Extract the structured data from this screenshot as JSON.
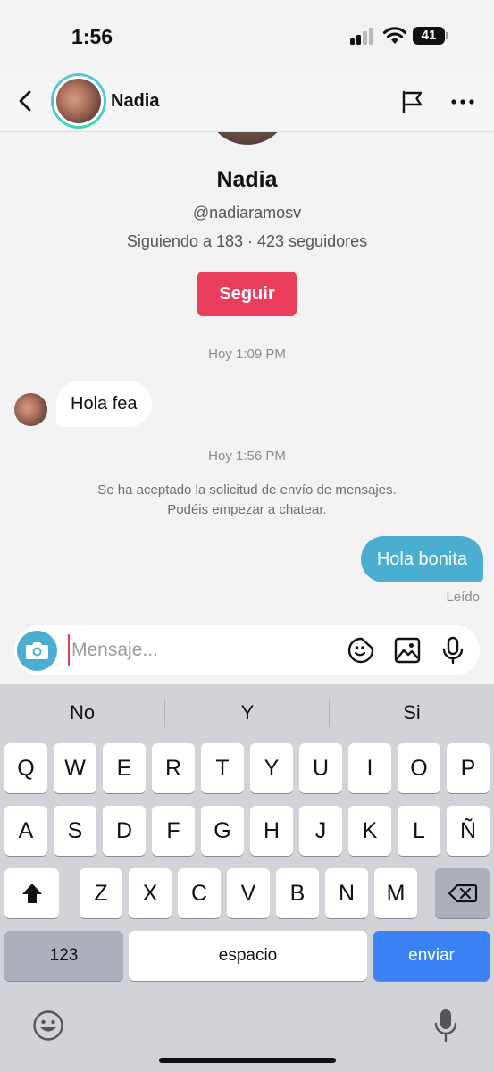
{
  "status_bar": {
    "time": "1:56",
    "battery": "41"
  },
  "header": {
    "name": "Nadia"
  },
  "profile": {
    "name": "Nadia",
    "handle": "@nadiaramosv",
    "stats": "Siguiendo a 183 · 423 seguidores",
    "follow_label": "Seguir"
  },
  "conversation": {
    "timestamp_1": "Hoy 1:09 PM",
    "incoming_message": "Hola fea",
    "timestamp_2": "Hoy 1:56 PM",
    "system_line_1": "Se ha aceptado la solicitud de envío de mensajes.",
    "system_line_2": "Podéis empezar a chatear.",
    "outgoing_message": "Hola bonita",
    "read_receipt": "Leído"
  },
  "composer": {
    "placeholder": "Mensaje..."
  },
  "keyboard": {
    "predictions": [
      "No",
      "Y",
      "Si"
    ],
    "row1": [
      "Q",
      "W",
      "E",
      "R",
      "T",
      "Y",
      "U",
      "I",
      "O",
      "P"
    ],
    "row2": [
      "A",
      "S",
      "D",
      "F",
      "G",
      "H",
      "J",
      "K",
      "L",
      "Ñ"
    ],
    "row3": [
      "Z",
      "X",
      "C",
      "V",
      "B",
      "N",
      "M"
    ],
    "numbers_label": "123",
    "space_label": "espacio",
    "send_label": "enviar"
  },
  "colors": {
    "accent_red": "#ea3c5b",
    "bubble_blue": "#4aaed0",
    "send_blue": "#3b82f6"
  }
}
